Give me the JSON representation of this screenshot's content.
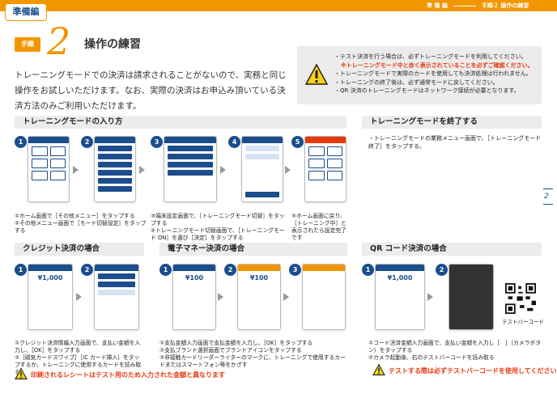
{
  "header": {
    "prep_tag": "準備編",
    "section": "準 備 編",
    "step_label": "手順２ 操作の練習"
  },
  "step": {
    "badge": "手順",
    "number": "2",
    "title": "操作の練習"
  },
  "intro": "トレーニングモードでの決済は請求されることがないので、実務と同じ操作をお試しいただけます。なお、実際の決済はお申込み頂いている決済方法のみご利用いただけます。",
  "warnings": [
    "・テスト決済を行う場合は、必ずトレーニングモードを利用してください。",
    "※トレーニングモード中と赤く表示されていることを必ずご確認ください。",
    "・トレーニングモードで実際のカードを使用しても決済処理は行われません。",
    "・トレーニングの終了後は、必ず通常モードに戻してください。",
    "・QR 決済のトレーニングモードはネットワーク接続が必要となります。"
  ],
  "sections": {
    "training_enter": "トレーニングモードの入り方",
    "training_exit": "トレーニングモードを終了する",
    "credit": "クレジット決済の場合",
    "emoney": "電子マネー決済の場合",
    "qr": "QR コード決済の場合"
  },
  "exit_text": "・トレーニングモードの業務メニュー画面で、［トレーニングモード終了］をタップする。",
  "captions": {
    "enter_12": "①ホーム画面で［その他メニュー］をタップする\n②その他メニュー画面で［モード切替設定］をタップする",
    "enter_34": "③端末設定画面で、［トレーニングモード切替］をタップする\n④トレーニングモード切替画面で、［トレーニングモード ON］を選び［決定］をタップする",
    "enter_5": "⑤ホーム画面に戻り、［トレーニング中］と表示されたら設定完了です",
    "credit": "①クレジット決済情報入力画面で、支払い金額を入力し、［OK］をタップする\n②［磁気カードスワイプ］［IC カード挿入］をタップするか、トレーニングに使用するカードを読み取る",
    "emoney": "①支払金額入力画面で支払金額を入力し、［OK］をタップする\n②支払ブランド選択画面でブランドアイコンをタップする\n③非接触カードリーダーライターのマークに、トレーニングで使用するカードまたはスマートフォン等をかざす",
    "qr": "①コード決済金額入力画面で、支払い金額を入力し［　］（カメラボタン）をタップする\n②カメラ起動後、右のテストバーコードを読み取る"
  },
  "credit_warn": "印刷されるレシートはテスト用のため入力された金額と異なります",
  "qr_warn": "テストする際は必ずテストバーコードを使用してください",
  "qr_label": "テストバーコード",
  "page_number": "2",
  "amount": "¥1,000",
  "amount_small": "¥100",
  "step_numbers": [
    "1",
    "2",
    "3",
    "4",
    "5"
  ],
  "colors": {
    "accent": "#f29600",
    "brand": "#1a4e8c",
    "alert": "#e8380d"
  }
}
